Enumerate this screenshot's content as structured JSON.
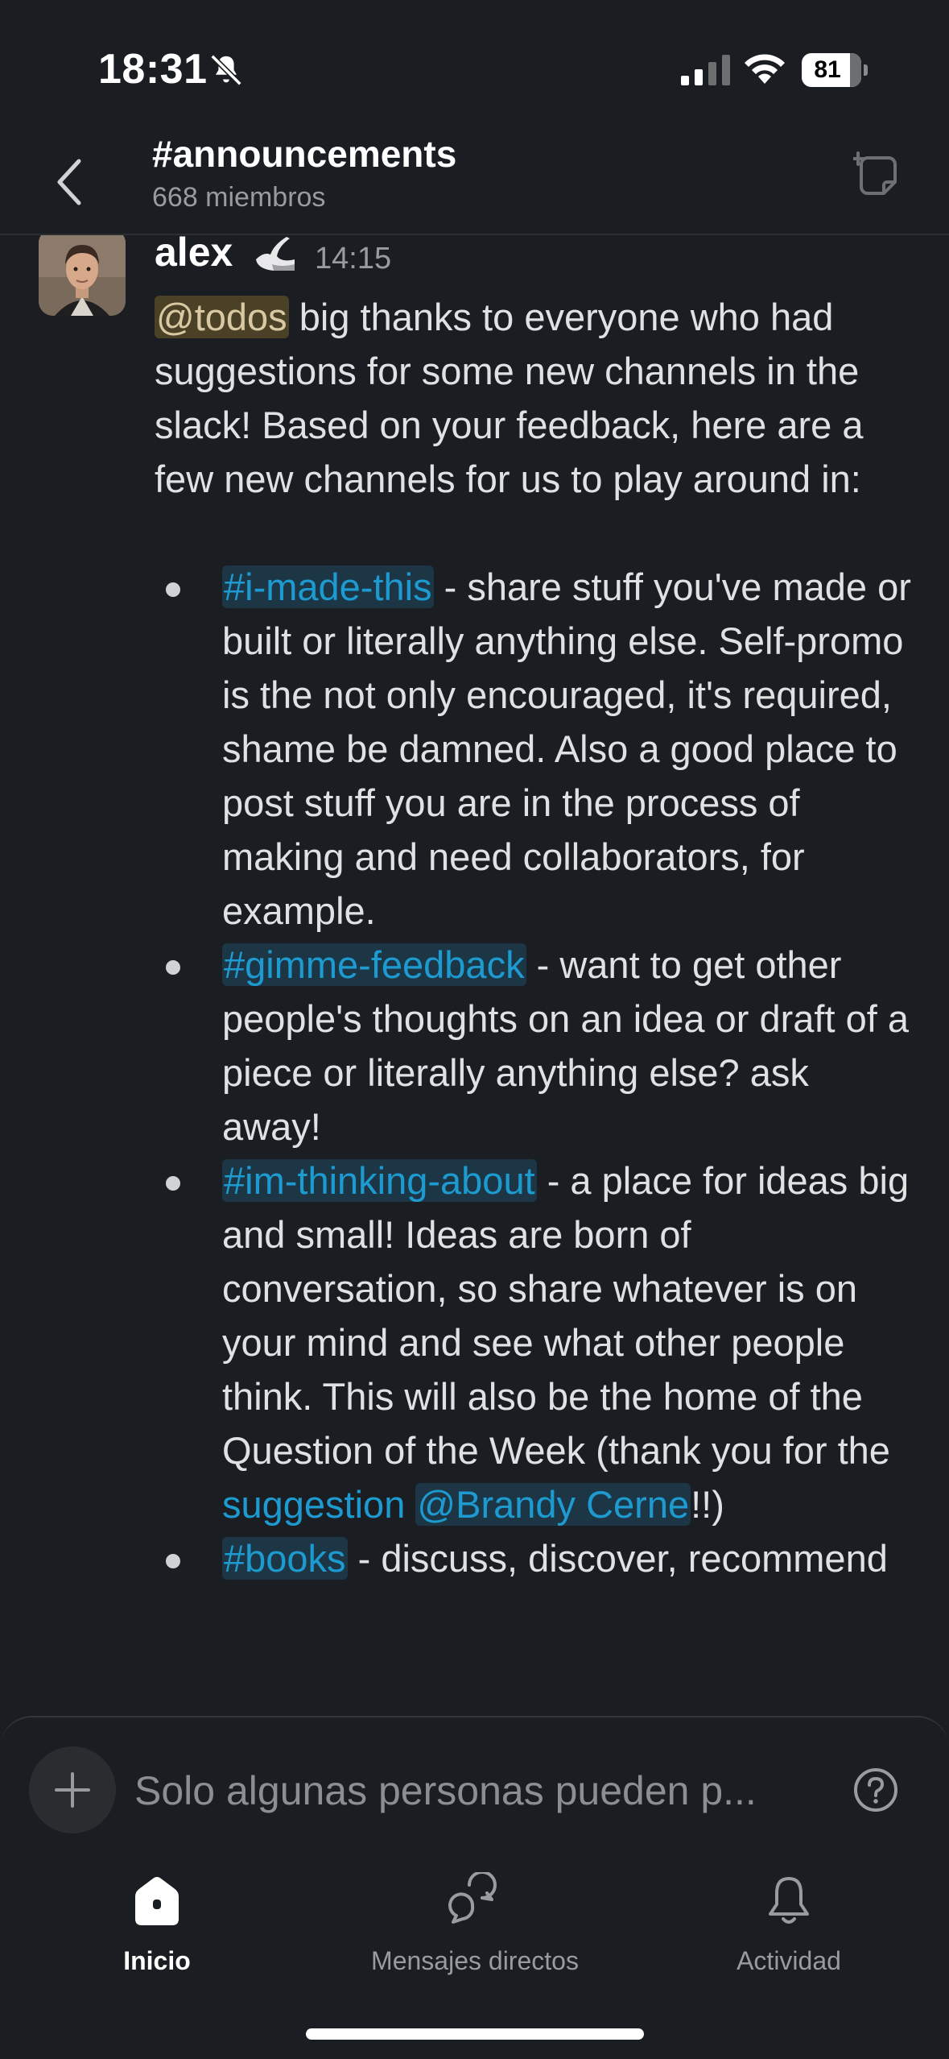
{
  "status_bar": {
    "time": "18:31",
    "battery": "81"
  },
  "header": {
    "channel_name": "#announcements",
    "members": "668 miembros"
  },
  "message": {
    "author": "alex",
    "time": "14:15",
    "mention": "@todos",
    "intro_text": " big thanks to everyone who had suggestions for some new channels in the slack! Based on your feedback, here are a few new channels for us to play around in:",
    "items": [
      {
        "channel": "#i-made-this",
        "text": " - share stuff you've made or built or literally anything else. Self-promo is the not only encouraged, it's required, shame be damned. Also a good place to post stuff you are in the process of making and need collaborators, for example."
      },
      {
        "channel": "#gimme-feedback",
        "text": " - want to get other people's thoughts on an idea or draft of a piece or literally anything else? ask away!"
      },
      {
        "channel": "#im-thinking-about",
        "text": " - a place for ideas big and small! Ideas are born of conversation, so share whatever is on your mind and see what other people think. This will also be the home of the Question of the Week (thank you for the ",
        "link_text": "suggestion",
        "user_mention": "@Brandy Cerne",
        "tail": "!!)"
      },
      {
        "channel": "#books",
        "text": " - discuss, discover, recommend"
      }
    ]
  },
  "composer": {
    "placeholder": "Solo algunas personas pueden p..."
  },
  "tabs": {
    "home": "Inicio",
    "dms": "Mensajes directos",
    "activity": "Actividad"
  },
  "icons": {
    "back": "chevron-left-icon",
    "compose": "compose-icon",
    "mute": "bell-off-icon",
    "plus": "plus-icon",
    "help": "help-icon"
  },
  "colors": {
    "background": "#1a1d21",
    "link": "#1d9bd1",
    "mention_bg": "#4a4127"
  }
}
